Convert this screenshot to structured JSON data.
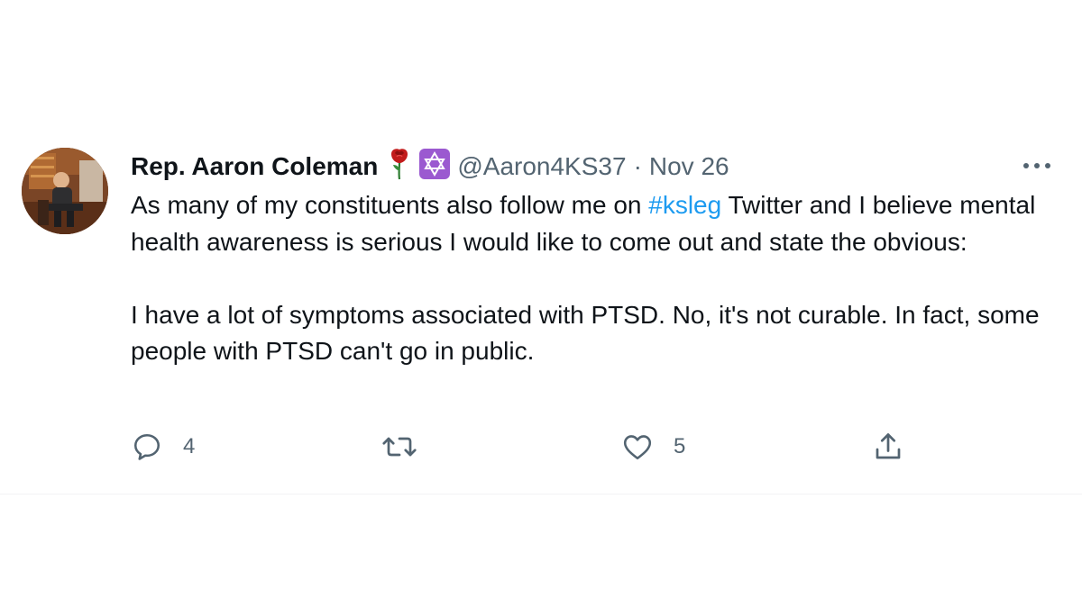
{
  "tweet": {
    "display_name": "Rep. Aaron Coleman",
    "badges": [
      "rose-emoji",
      "star-of-david-emoji"
    ],
    "handle": "@Aaron4KS37",
    "separator": "·",
    "date": "Nov 26",
    "text_para1_before": "As many of my constituents also follow me on ",
    "hashtag": "#ksleg",
    "text_para1_after": " Twitter and I believe mental health awareness is serious I would like to come out and state the obvious:",
    "text_para2": "I have a lot of symptoms associated with PTSD. No, it's not curable. In fact, some people with PTSD can't go in public.",
    "actions": {
      "reply_count": "4",
      "retweet_count": "",
      "like_count": "5"
    },
    "colors": {
      "text": "#0f1419",
      "secondary": "#536471",
      "link": "#1d9bf0",
      "badge_purple": "#9b59d0"
    }
  }
}
